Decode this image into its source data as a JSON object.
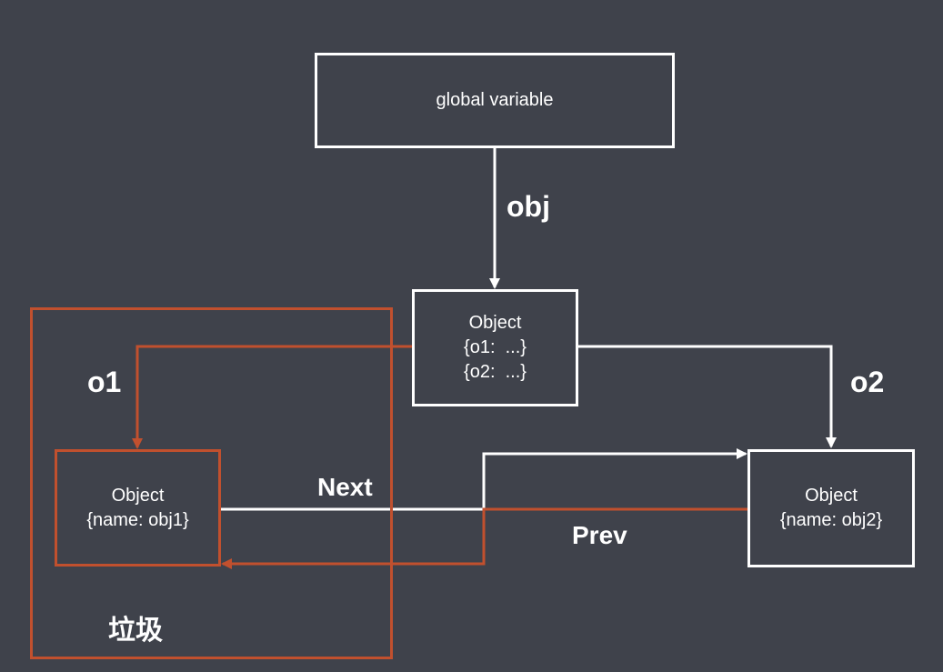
{
  "nodes": {
    "global": {
      "label": "global variable"
    },
    "root": {
      "title": "Object",
      "line1": "{o1:  ...}",
      "line2": "{o2:  ...}"
    },
    "obj1": {
      "title": "Object",
      "line1": "{name: obj1}"
    },
    "obj2": {
      "title": "Object",
      "line1": "{name: obj2}"
    }
  },
  "edges": {
    "obj": "obj",
    "o1": "o1",
    "o2": "o2",
    "next": "Next",
    "prev": "Prev"
  },
  "zone": {
    "label": "垃圾"
  },
  "colors": {
    "background": "#3f424b",
    "live": "#ffffff",
    "garbage": "#c1502e"
  }
}
